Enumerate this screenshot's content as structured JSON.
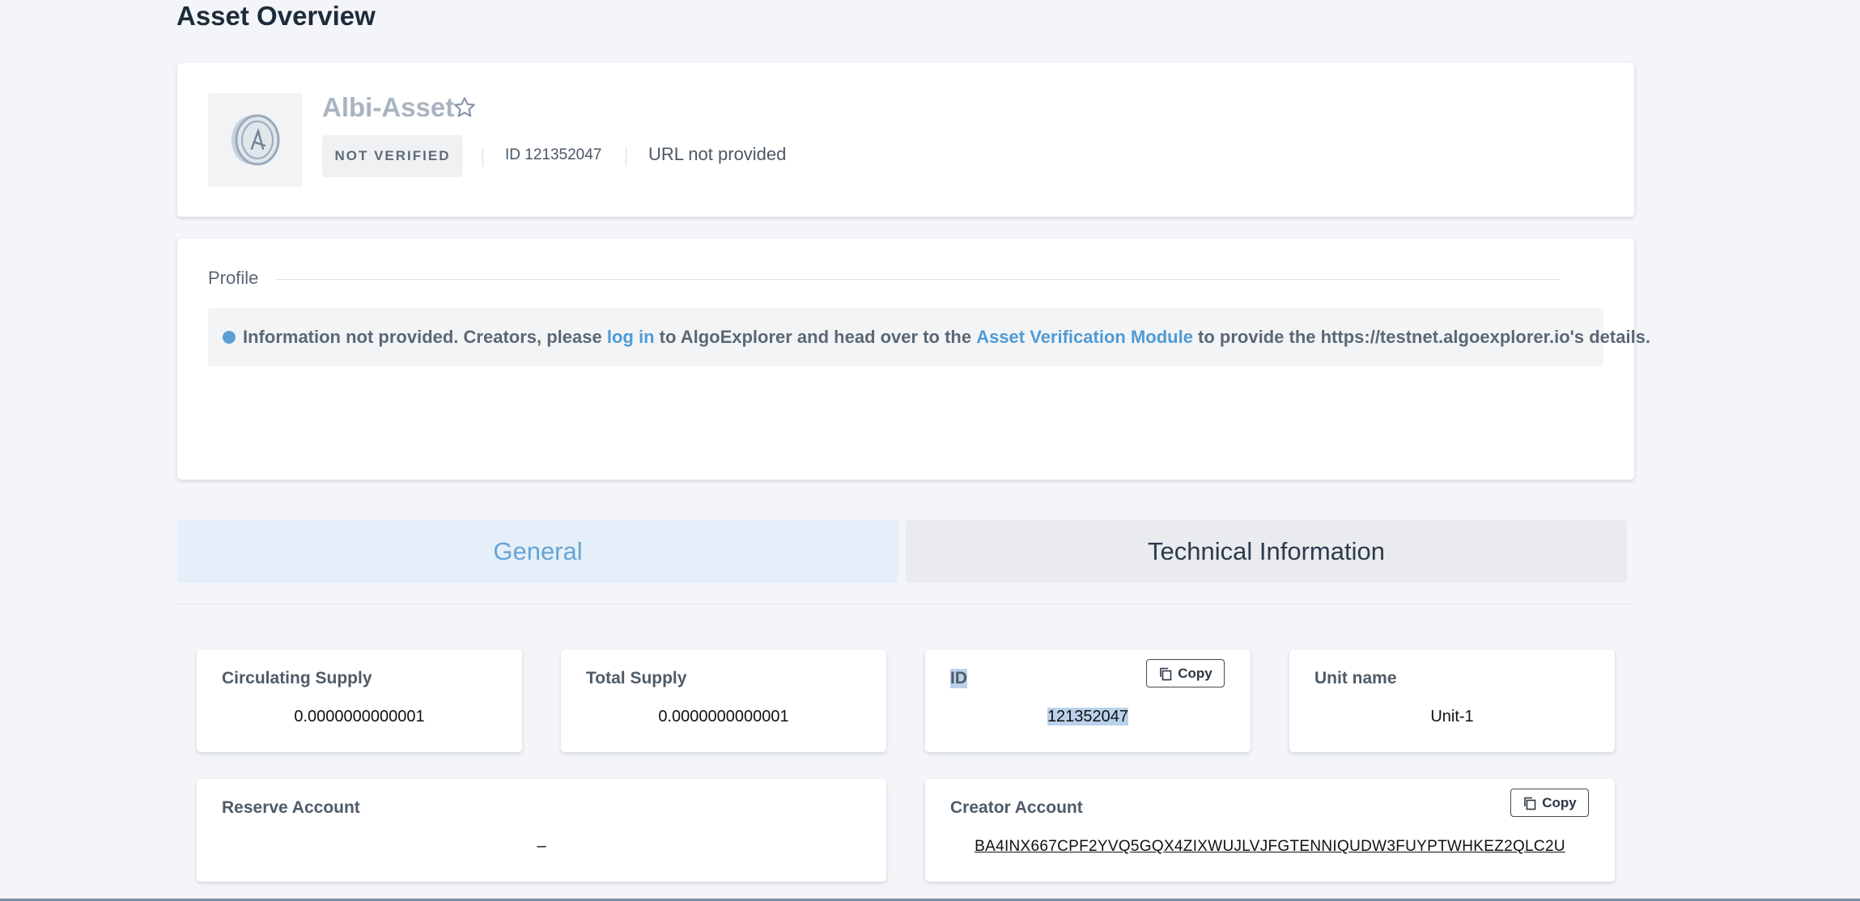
{
  "page": {
    "title": "Asset Overview"
  },
  "asset": {
    "name": "Albi-Asset",
    "verification": "NOT VERIFIED",
    "id_label": "ID 121352047",
    "url": "URL not provided",
    "icons": {
      "logo": "coin-icon",
      "favorite": "star-outline-icon"
    }
  },
  "profile": {
    "label": "Profile",
    "info": {
      "part1": "Information not provided. Creators, please ",
      "link1": "log in",
      "part2": " to AlgoExplorer and head over to the ",
      "link2": "Asset Verification Module",
      "part3": " to provide the https://testnet.algoexplorer.io's details."
    }
  },
  "tabs": [
    {
      "label": "General",
      "active": true
    },
    {
      "label": "Technical Information",
      "active": false
    }
  ],
  "stats": {
    "circulating": {
      "title": "Circulating Supply",
      "value": "0.0000000000001"
    },
    "total": {
      "title": "Total Supply",
      "value": "0.0000000000001"
    },
    "id": {
      "title": "ID",
      "value": "121352047",
      "copy": "Copy"
    },
    "unit": {
      "title": "Unit name",
      "value": "Unit-1"
    },
    "reserve": {
      "title": "Reserve Account",
      "value": "–"
    },
    "creator": {
      "title": "Creator Account",
      "value": "BA4INX667CPF2YVQ5GQX4ZIXWUJLVJFGTENNIQUDW3FUYPTWHKEZ2QLC2U",
      "copy": "Copy"
    }
  },
  "colors": {
    "accent": "#4f9bd6",
    "tab_active_bg": "#e4eff9",
    "selection": "#b9d1ea"
  }
}
